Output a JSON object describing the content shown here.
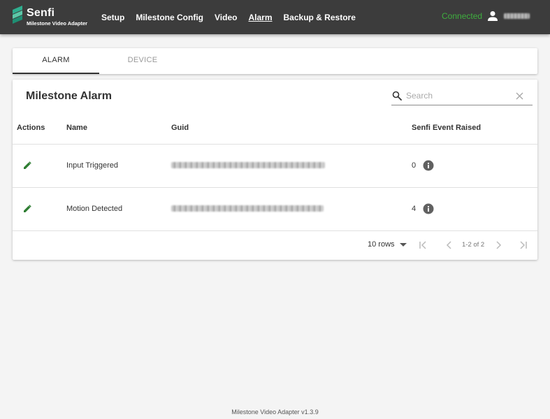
{
  "header": {
    "brand": "Senfi",
    "brand_subtitle": "Milestone Video Adapter",
    "nav": [
      {
        "label": "Setup",
        "active": false
      },
      {
        "label": "Milestone Config",
        "active": false
      },
      {
        "label": "Video",
        "active": false
      },
      {
        "label": "Alarm",
        "active": true
      },
      {
        "label": "Backup & Restore",
        "active": false
      }
    ],
    "connection_status": "Connected",
    "user_icon": "person-icon"
  },
  "tabs": [
    {
      "label": "ALARM",
      "selected": true
    },
    {
      "label": "DEVICE",
      "selected": false
    }
  ],
  "card": {
    "title": "Milestone Alarm",
    "search": {
      "placeholder": "Search",
      "value": ""
    },
    "columns": [
      "Actions",
      "Name",
      "Guid",
      "Senfi Event Raised"
    ],
    "rows": [
      {
        "name": "Input Triggered",
        "events": "0"
      },
      {
        "name": "Motion Detected",
        "events": "4"
      }
    ],
    "pagination": {
      "rows_per_page": "10 rows",
      "range": "1-2 of 2"
    }
  },
  "footer": "Milestone Video Adapter v1.3.9",
  "colors": {
    "topbar": "#3c3c3c",
    "brand_accent": "#2fae8f",
    "connected": "#3fae3f",
    "edit_icon": "#2e7d32",
    "background": "#f4f4f4"
  }
}
